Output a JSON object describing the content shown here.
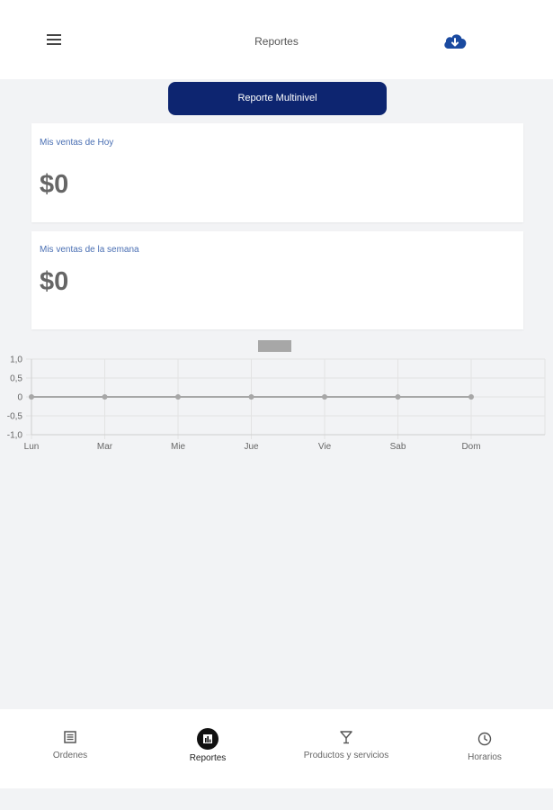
{
  "header": {
    "title": "Reportes",
    "menu_icon": "hamburger-menu-icon",
    "download_icon": "cloud-download-icon",
    "accent": "#1a4aa0"
  },
  "report_button": {
    "label": "Reporte Multinivel",
    "color": "#0d2570"
  },
  "cards": {
    "today": {
      "label": "Mis ventas de Hoy",
      "value": "$0"
    },
    "week": {
      "label": "Mis ventas de la semana",
      "value": "$0"
    }
  },
  "chart_data": {
    "type": "line",
    "categories": [
      "Lun",
      "Mar",
      "Mie",
      "Jue",
      "Vie",
      "Sab",
      "Dom"
    ],
    "series": [
      {
        "values": [
          0,
          0,
          0,
          0,
          0,
          0,
          0
        ],
        "color": "#a7a7a7"
      }
    ],
    "ylim": [
      -1.0,
      1.0
    ],
    "y_ticks": [
      "1,0",
      "0,5",
      "0",
      "-0,5",
      "-1,0"
    ],
    "y_tick_values": [
      1.0,
      0.5,
      0,
      -0.5,
      -1.0
    ],
    "grid": true,
    "legend": "top"
  },
  "bottom_nav": {
    "items": [
      {
        "label": "Ordenes",
        "icon": "list-icon",
        "active": false
      },
      {
        "label": "Reportes",
        "icon": "bar-chart-icon",
        "active": true
      },
      {
        "label": "Productos y servicios",
        "icon": "cocktail-glass-icon",
        "active": false
      },
      {
        "label": "Horarios",
        "icon": "clock-icon",
        "active": false
      }
    ]
  }
}
